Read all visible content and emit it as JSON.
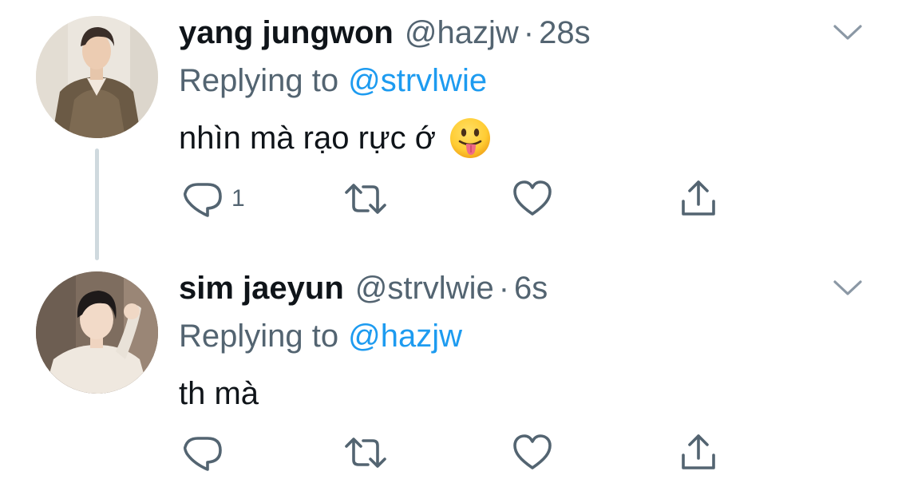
{
  "tweets": [
    {
      "display_name": "yang jungwon",
      "handle": "@hazjw",
      "separator": "·",
      "time": "28s",
      "replying_prefix": "Replying to",
      "replying_to": "@strvlwie",
      "text": "nhìn mà rạo rực ớ",
      "emoji_icon": "face-with-tongue-icon",
      "reply_count": "1",
      "retweet_count": "",
      "like_count": ""
    },
    {
      "display_name": "sim jaeyun",
      "handle": "@strvlwie",
      "separator": "·",
      "time": "6s",
      "replying_prefix": "Replying to",
      "replying_to": "@hazjw",
      "text": "th mà",
      "reply_count": "",
      "retweet_count": "",
      "like_count": ""
    }
  ],
  "icons": {
    "more": "chevron-down-icon",
    "reply": "reply-icon",
    "retweet": "retweet-icon",
    "like": "heart-icon",
    "share": "share-icon"
  },
  "colors": {
    "text": "#0f1419",
    "secondary": "#536471",
    "accent": "#1d9bf0",
    "thread_line": "#cfd9de",
    "chevron": "#8b98a5"
  }
}
